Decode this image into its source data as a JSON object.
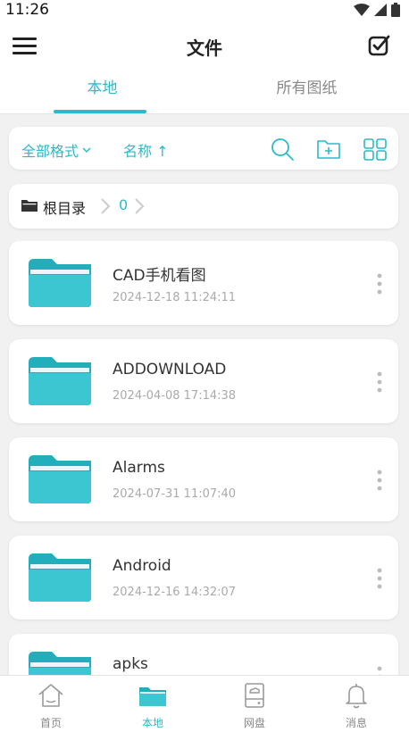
{
  "status_bar": {
    "time": "11:26"
  },
  "header": {
    "title": "文件",
    "tabs": [
      {
        "label": "本地",
        "active": true
      },
      {
        "label": "所有图纸",
        "active": false
      }
    ]
  },
  "toolbar": {
    "format_filter": "全部格式",
    "sort": "名称 ↑",
    "icons": [
      "search-icon",
      "new-folder-icon",
      "grid-view-icon"
    ]
  },
  "breadcrumb": {
    "root": "根目录",
    "current": "0"
  },
  "files": [
    {
      "name": "CAD手机看图",
      "date": "2024-12-18 11:24:11"
    },
    {
      "name": "ADDOWNLOAD",
      "date": "2024-04-08 17:14:38"
    },
    {
      "name": "Alarms",
      "date": "2024-07-31 11:07:40"
    },
    {
      "name": "Android",
      "date": "2024-12-16 14:32:07"
    },
    {
      "name": "apks",
      "date": ""
    }
  ],
  "bottom_nav": [
    {
      "label": "首页",
      "icon": "home-icon",
      "active": false
    },
    {
      "label": "本地",
      "icon": "folder-icon",
      "active": true
    },
    {
      "label": "网盘",
      "icon": "cloud-drive-icon",
      "active": false
    },
    {
      "label": "消息",
      "icon": "bell-icon",
      "active": false
    }
  ],
  "colors": {
    "accent": "#2cbac7",
    "folder": "#36c4cf",
    "background": "#f1f1f1"
  }
}
